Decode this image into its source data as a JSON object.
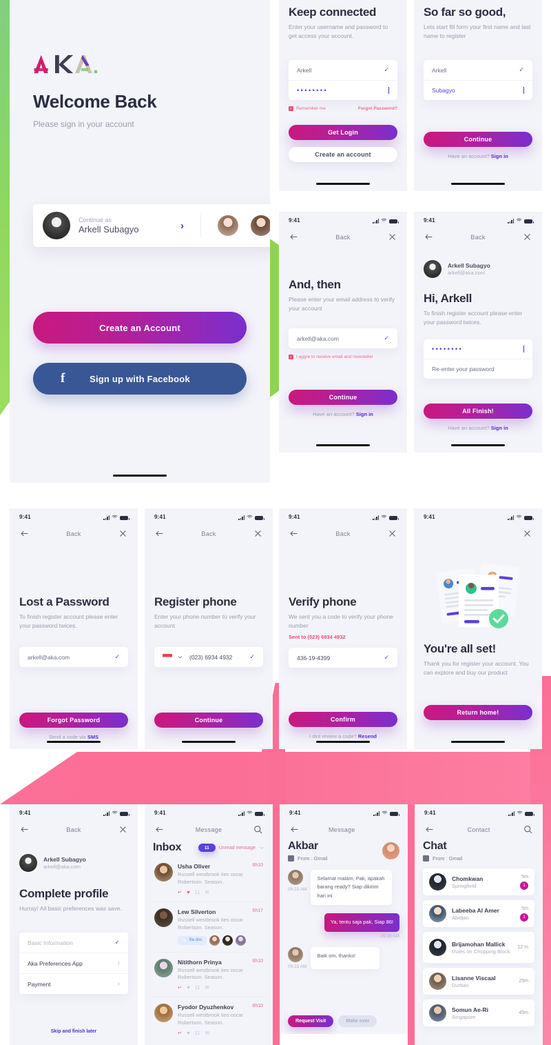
{
  "brand": {
    "logo_text": "AKA",
    "accent_purple": "#4b2fd6",
    "accent_pink": "#c9187f",
    "accent_green": "#8ed453",
    "accent_rose": "#fb6e95",
    "facebook_blue": "#3a5795"
  },
  "status_bar": {
    "time": "9:41"
  },
  "common": {
    "back_label": "Back",
    "have_account": "Have an account?",
    "sign_in": "Sign in"
  },
  "welcome": {
    "title": "Welcome Back",
    "subtitle": "Please sign in your account",
    "continue_label": "Continue as",
    "user_name": "Arkell Subagyo",
    "create_account": "Create an Account",
    "facebook": "Sign up with Facebook"
  },
  "login": {
    "title": "Keep connected",
    "subtitle": "Enter your username and password to get access your account.",
    "username_value": "Arkell",
    "password_value": "••••••••",
    "remember_label": "Remember me",
    "forgot_label": "Forgot Password?",
    "primary": "Get Login",
    "secondary": "Create an account"
  },
  "register_name": {
    "title": "So far so good,",
    "subtitle": "Lets start fill form your first name and last name to register",
    "first_name": "Arkell",
    "last_name": "Subagyo",
    "primary": "Continue"
  },
  "email_step": {
    "title": "And, then",
    "subtitle": "Please enter your email address to verify your account",
    "email_value": "arkell@aka.com",
    "consent": "I aggre to receive email and newsletter",
    "primary": "Continue"
  },
  "password_step": {
    "user_name": "Arkell Subagyo",
    "user_email": "arkell@aka.com",
    "title": "Hi, Arkell",
    "subtitle": "To finish register account please enter your password twices.",
    "password_value": "••••••••",
    "confirm_placeholder": "Re-enter your password",
    "primary": "All Finish!"
  },
  "lost_password": {
    "title": "Lost a Password",
    "subtitle": "To finish register account please enter your password twices.",
    "email_value": "arkell@aka.com",
    "primary": "Forgot Password",
    "foot_prefix": "Send a code via",
    "foot_link": "SMS"
  },
  "register_phone": {
    "title": "Register phone",
    "subtitle": "Enter your phone number to verify your account",
    "phone_value": "(023) 6934 4932",
    "primary": "Continue"
  },
  "verify_phone": {
    "title": "Verify phone",
    "subtitle": "We sent you a code to verify your phone number",
    "sent_to": "Sent to (023) 6934 4932",
    "code_value": "436-19-4399",
    "primary": "Confirm",
    "foot_prefix": "I dint review a code?",
    "foot_link": "Resend"
  },
  "all_set": {
    "title": "You're all set!",
    "subtitle": "Thank you for register your account. You can explore and buy our product",
    "primary": "Return home!"
  },
  "complete_profile": {
    "user_name": "Arkell Subagyo",
    "user_email": "arkell@aka.com",
    "title": "Complete profile",
    "subtitle": "Hurray! All basic preferences was save.",
    "items": [
      {
        "label": "Basic Information",
        "state": "done"
      },
      {
        "label": "Aka Preferences App",
        "state": "pending"
      },
      {
        "label": "Payment",
        "state": "pending"
      }
    ],
    "skip_label": "Skip and finish later"
  },
  "inbox": {
    "nav_title": "Message",
    "heading": "Inbox",
    "filter_count": "11",
    "filter_label": "Unread message",
    "rows": [
      {
        "name": "Usha Oliver",
        "preview": "Russell westbrook ties oscar Robertson. Season.",
        "time": "8h10",
        "liked": true
      },
      {
        "name": "Lew Silverton",
        "preview": "Russell westbrook ties oscar Robertson. Season.",
        "time": "6h17",
        "attachment": "file.doc"
      },
      {
        "name": "Nitithorn Prinya",
        "preview": "Russell westbrook ties oscar Robertson. Season.",
        "time": "8h10",
        "liked": false
      },
      {
        "name": "Fyodor Dyuzhenkov",
        "preview": "Russell westbrook ties oscar Robertson. Season.",
        "time": "8h10",
        "liked": false
      }
    ]
  },
  "chat": {
    "nav_title": "Message",
    "heading": "Akbar",
    "source": "From : Gmail",
    "messages": [
      {
        "dir": "in",
        "text": "Selamat malam, Pak, apakah barang ready? Siap dikirim hari ini",
        "time": "09:23 AM"
      },
      {
        "dir": "out",
        "text": "Ya, tentu saja pak, Siap 86!",
        "time": "09:29 AM"
      },
      {
        "dir": "in",
        "text": "Baik om, thanks!",
        "time": "09:23 AM"
      }
    ],
    "action_primary": "Request Visit",
    "action_secondary": "Make over"
  },
  "contacts": {
    "nav_title": "Contact",
    "heading": "Chat",
    "source": "From : Gmail",
    "rows": [
      {
        "name": "Chomkwan",
        "sub": "Springfield",
        "time": "5m",
        "badge": "1"
      },
      {
        "name": "Labeeba Al Amer",
        "sub": "Abidjan",
        "time": "5m",
        "badge": "1"
      },
      {
        "name": "Brijamohan Mallick",
        "sub": "Rules on Chopping Block",
        "time": "12 m",
        "badge": ""
      },
      {
        "name": "Lisanne Viscaal",
        "sub": "Durban",
        "time": "25m",
        "badge": ""
      },
      {
        "name": "Somun Ae-Ri",
        "sub": "Singapore",
        "time": "45m",
        "badge": ""
      }
    ]
  },
  "icons": {
    "back_arrow": "back-arrow-icon",
    "close": "close-icon",
    "search": "search-icon",
    "chevron_right": "chevron-right-icon",
    "chevron_down": "chevron-down-icon",
    "check": "check-icon",
    "facebook": "facebook-icon"
  }
}
